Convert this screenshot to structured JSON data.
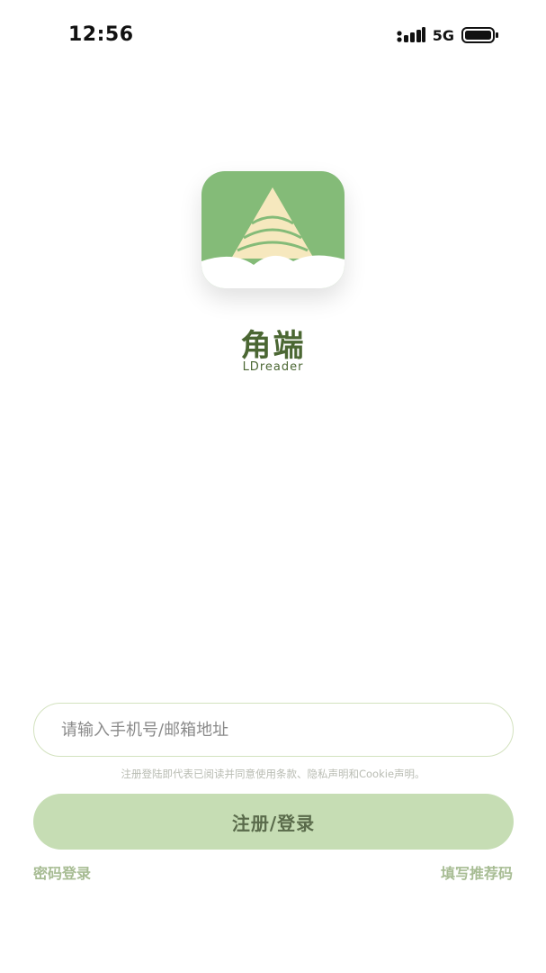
{
  "status_bar": {
    "time": "12:56",
    "network": "5G",
    "icons": [
      "signal-icon",
      "battery-icon"
    ]
  },
  "brand": {
    "name": "角端",
    "subtitle": "LDreader",
    "accent_color": "#4b6733",
    "icon_bg_color": "#84bb78"
  },
  "login": {
    "input_placeholder": "请输入手机号/邮箱地址",
    "agreement_text": "注册登陆即代表已阅读并同意使用条款、隐私声明和Cookie声明。",
    "submit_label": "注册/登录",
    "button_color": "#c6ddb4",
    "password_login_link": "密码登录",
    "referral_code_link": "填写推荐码"
  }
}
